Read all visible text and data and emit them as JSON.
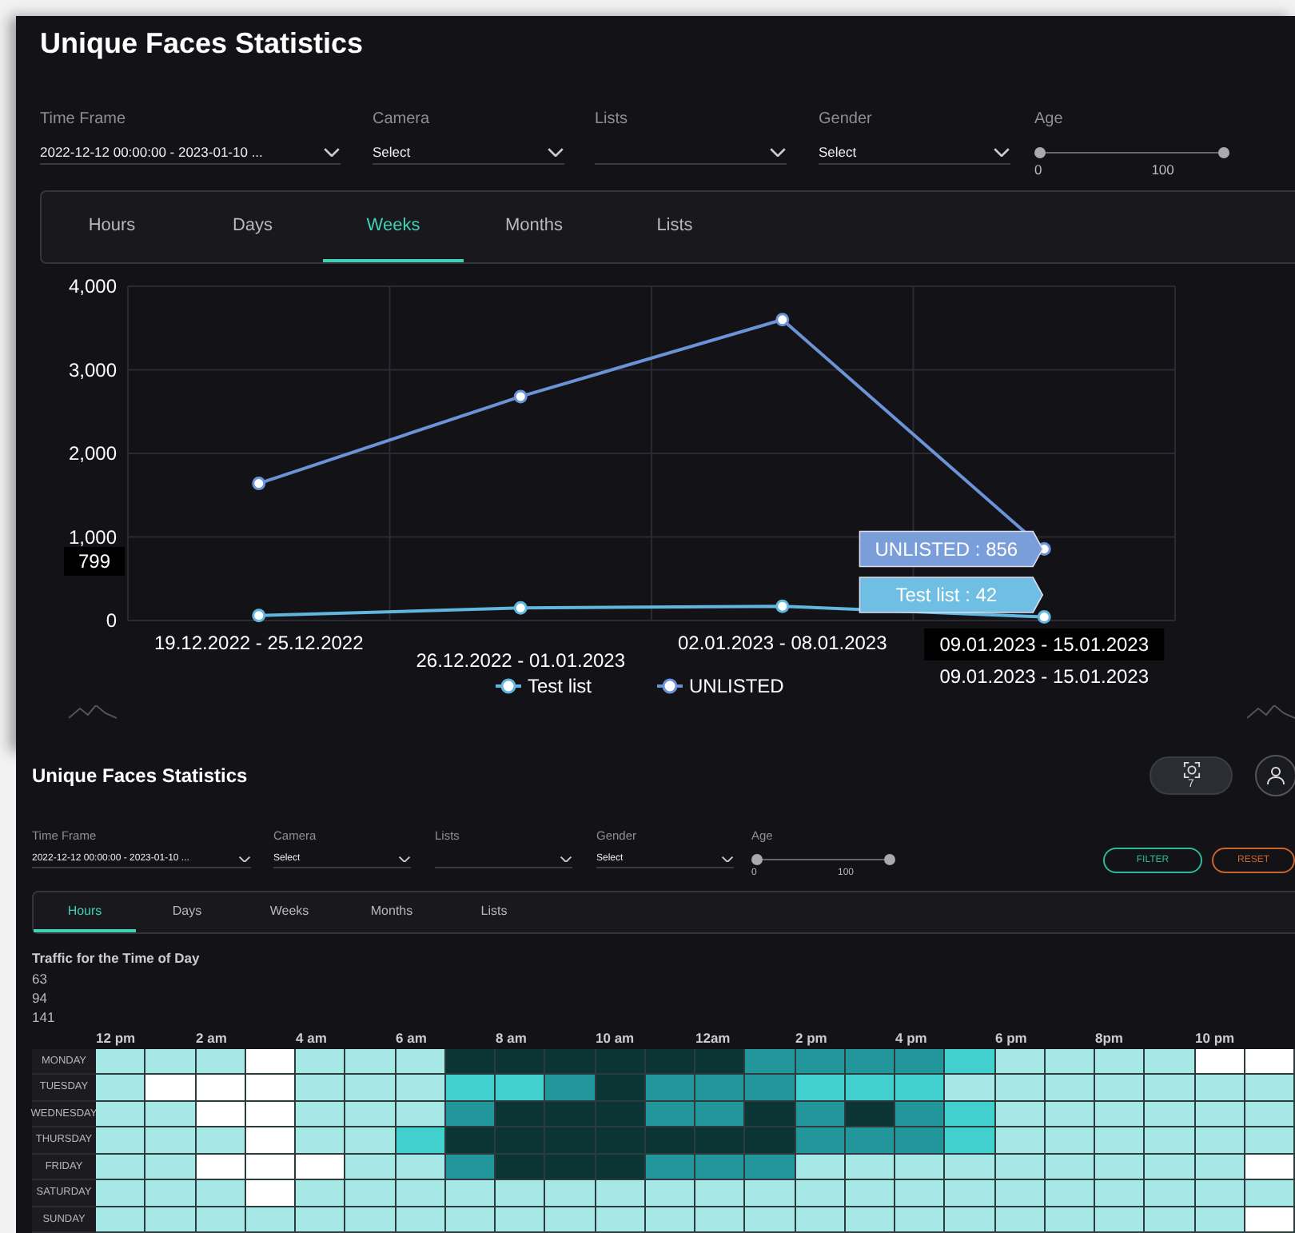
{
  "overview": {
    "title": "Unique Faces Statistics",
    "filters": [
      {
        "kind": "select",
        "label": "Time Frame",
        "value": "2022-12-12 00:00:00 - 2023-01-10 ..."
      },
      {
        "kind": "select",
        "label": "Camera",
        "placeholder": "Select"
      },
      {
        "kind": "select",
        "label": "Lists"
      },
      {
        "kind": "select",
        "label": "Gender",
        "placeholder": "Select"
      },
      {
        "kind": "range",
        "label": "Age",
        "min": "0",
        "max": "100"
      }
    ],
    "tabs": [
      {
        "label": "Hours",
        "selected": false
      },
      {
        "label": "Days",
        "selected": false
      },
      {
        "label": "Weeks",
        "selected": true
      },
      {
        "label": "Months",
        "selected": false
      },
      {
        "label": "Lists",
        "selected": false
      }
    ],
    "chart_data": {
      "type": "line",
      "grid": true,
      "legend": "bottom",
      "categories": [
        "19.12.2022 - 25.12.2022",
        "26.12.2022 - 01.01.2023",
        "02.01.2023 - 08.01.2023",
        "09.01.2023 - 15.01.2023"
      ],
      "series": [
        {
          "name": "Test list",
          "color": "#5fb7e0",
          "marker": "circle",
          "values": [
            60,
            150,
            170,
            42
          ]
        },
        {
          "name": "UNLISTED",
          "color": "#6b93d6",
          "marker": "circle",
          "values": [
            1640,
            2680,
            3600,
            856
          ]
        }
      ],
      "ylim": [
        0,
        4000
      ],
      "yticks": [
        {
          "value": 0,
          "label": "0"
        },
        {
          "value": 1000,
          "label": "1,000"
        },
        {
          "value": 2000,
          "label": "2,000"
        },
        {
          "value": 3000,
          "label": "3,000"
        },
        {
          "value": 4000,
          "label": "4,000"
        }
      ],
      "annotations": [
        {
          "text": "UNLISTED : 856",
          "x": "09.01.2023 - 15.01.2023",
          "y": 856
        },
        {
          "text": "Test list : 42",
          "x": "09.01.2023 - 15.01.2023",
          "y": 42
        },
        "799",
        "09.01.2023 - 15.01.2023"
      ]
    }
  },
  "hourly": {
    "title": "Unique Faces Statistics",
    "badge": "7",
    "filters": [
      {
        "kind": "select",
        "label": "Time Frame",
        "value": "2022-12-12 00:00:00 - 2023-01-10 ..."
      },
      {
        "kind": "select",
        "label": "Camera",
        "placeholder": "Select"
      },
      {
        "kind": "select",
        "label": "Lists"
      },
      {
        "kind": "select",
        "label": "Gender",
        "placeholder": "Select"
      },
      {
        "kind": "range",
        "label": "Age",
        "min": "0",
        "max": "100"
      }
    ],
    "actions": [
      {
        "kind": "primary",
        "label": "FILTER"
      },
      {
        "kind": "danger",
        "label": "RESET"
      }
    ],
    "tabs": [
      {
        "label": "Hours",
        "selected": true
      },
      {
        "label": "Days",
        "selected": false
      },
      {
        "label": "Weeks",
        "selected": false
      },
      {
        "label": "Months",
        "selected": false
      },
      {
        "label": "Lists",
        "selected": false
      }
    ],
    "heatmap": {
      "title": "Traffic for the Time of Day",
      "legend": [
        "63",
        "94",
        "141"
      ],
      "hours": [
        "12 pm",
        "2 am",
        "4 am",
        "6 am",
        "8 am",
        "10 am",
        "12am",
        "2 pm",
        "4 pm",
        "6 pm",
        "8pm",
        "10 pm"
      ],
      "rows": [
        {
          "day": "MONDAY",
          "cells": [
            {
              "color": "#a6e8e6"
            },
            {
              "color": "#a6e8e6"
            },
            {
              "color": "#a6e8e6"
            },
            {
              "color": "#ffffff"
            },
            {
              "color": "#a6e8e6"
            },
            {
              "color": "#a6e8e6"
            },
            {
              "color": "#a6e8e6"
            },
            {
              "color": "#0b3535"
            },
            {
              "color": "#0b3535"
            },
            {
              "color": "#0b3535"
            },
            {
              "color": "#0b3535"
            },
            {
              "color": "#0b3535"
            },
            {
              "color": "#0b3535"
            },
            {
              "color": "#22979b"
            },
            {
              "color": "#22979b"
            },
            {
              "color": "#22979b"
            },
            {
              "color": "#22979b"
            },
            {
              "color": "#40d0ce"
            },
            {
              "color": "#a6e8e6"
            },
            {
              "color": "#a6e8e6"
            },
            {
              "color": "#a6e8e6"
            },
            {
              "color": "#a6e8e6"
            },
            {
              "color": "#ffffff"
            },
            {
              "color": "#ffffff"
            }
          ]
        },
        {
          "day": "TUESDAY",
          "cells": [
            {
              "color": "#a6e8e6"
            },
            {
              "color": "#ffffff"
            },
            {
              "color": "#ffffff"
            },
            {
              "color": "#ffffff"
            },
            {
              "color": "#a6e8e6"
            },
            {
              "color": "#a6e8e6"
            },
            {
              "color": "#a6e8e6"
            },
            {
              "color": "#40d0ce"
            },
            {
              "color": "#40d0ce"
            },
            {
              "color": "#22979b"
            },
            {
              "color": "#0b3535"
            },
            {
              "color": "#22979b"
            },
            {
              "color": "#22979b"
            },
            {
              "color": "#22979b"
            },
            {
              "color": "#40d0ce"
            },
            {
              "color": "#40d0ce"
            },
            {
              "color": "#40d0ce"
            },
            {
              "color": "#a6e8e6"
            },
            {
              "color": "#a6e8e6"
            },
            {
              "color": "#a6e8e6"
            },
            {
              "color": "#a6e8e6"
            },
            {
              "color": "#a6e8e6"
            },
            {
              "color": "#a6e8e6"
            },
            {
              "color": "#a6e8e6"
            }
          ]
        },
        {
          "day": "WEDNESDAY",
          "cells": [
            {
              "color": "#a6e8e6"
            },
            {
              "color": "#a6e8e6"
            },
            {
              "color": "#ffffff"
            },
            {
              "color": "#ffffff"
            },
            {
              "color": "#a6e8e6"
            },
            {
              "color": "#a6e8e6"
            },
            {
              "color": "#a6e8e6"
            },
            {
              "color": "#22979b"
            },
            {
              "color": "#0b3535"
            },
            {
              "color": "#0b3535"
            },
            {
              "color": "#0b3535"
            },
            {
              "color": "#22979b"
            },
            {
              "color": "#22979b"
            },
            {
              "color": "#0b3535"
            },
            {
              "color": "#22979b"
            },
            {
              "color": "#0b3535"
            },
            {
              "color": "#22979b"
            },
            {
              "color": "#40d0ce"
            },
            {
              "color": "#a6e8e6"
            },
            {
              "color": "#a6e8e6"
            },
            {
              "color": "#a6e8e6"
            },
            {
              "color": "#a6e8e6"
            },
            {
              "color": "#a6e8e6"
            },
            {
              "color": "#a6e8e6"
            }
          ]
        },
        {
          "day": "THURSDAY",
          "cells": [
            {
              "color": "#a6e8e6"
            },
            {
              "color": "#a6e8e6"
            },
            {
              "color": "#a6e8e6"
            },
            {
              "color": "#ffffff"
            },
            {
              "color": "#a6e8e6"
            },
            {
              "color": "#a6e8e6"
            },
            {
              "color": "#40d0ce"
            },
            {
              "color": "#0b3535"
            },
            {
              "color": "#0b3535"
            },
            {
              "color": "#0b3535"
            },
            {
              "color": "#0b3535"
            },
            {
              "color": "#0b3535"
            },
            {
              "color": "#0b3535"
            },
            {
              "color": "#0b3535"
            },
            {
              "color": "#22979b"
            },
            {
              "color": "#22979b"
            },
            {
              "color": "#22979b"
            },
            {
              "color": "#40d0ce"
            },
            {
              "color": "#a6e8e6"
            },
            {
              "color": "#a6e8e6"
            },
            {
              "color": "#a6e8e6"
            },
            {
              "color": "#a6e8e6"
            },
            {
              "color": "#a6e8e6"
            },
            {
              "color": "#a6e8e6"
            }
          ]
        },
        {
          "day": "FRIDAY",
          "cells": [
            {
              "color": "#a6e8e6"
            },
            {
              "color": "#a6e8e6"
            },
            {
              "color": "#ffffff"
            },
            {
              "color": "#ffffff"
            },
            {
              "color": "#ffffff"
            },
            {
              "color": "#a6e8e6"
            },
            {
              "color": "#a6e8e6"
            },
            {
              "color": "#22979b"
            },
            {
              "color": "#0b3535"
            },
            {
              "color": "#0b3535"
            },
            {
              "color": "#0b3535"
            },
            {
              "color": "#22979b"
            },
            {
              "color": "#22979b"
            },
            {
              "color": "#22979b"
            },
            {
              "color": "#a6e8e6"
            },
            {
              "color": "#a6e8e6"
            },
            {
              "color": "#a6e8e6"
            },
            {
              "color": "#a6e8e6"
            },
            {
              "color": "#a6e8e6"
            },
            {
              "color": "#a6e8e6"
            },
            {
              "color": "#a6e8e6"
            },
            {
              "color": "#a6e8e6"
            },
            {
              "color": "#a6e8e6"
            },
            {
              "color": "#ffffff"
            }
          ]
        },
        {
          "day": "SATURDAY",
          "cells": [
            {
              "color": "#a6e8e6"
            },
            {
              "color": "#a6e8e6"
            },
            {
              "color": "#a6e8e6"
            },
            {
              "color": "#ffffff"
            },
            {
              "color": "#a6e8e6"
            },
            {
              "color": "#a6e8e6"
            },
            {
              "color": "#a6e8e6"
            },
            {
              "color": "#a6e8e6"
            },
            {
              "color": "#a6e8e6"
            },
            {
              "color": "#a6e8e6"
            },
            {
              "color": "#a6e8e6"
            },
            {
              "color": "#a6e8e6"
            },
            {
              "color": "#a6e8e6"
            },
            {
              "color": "#a6e8e6"
            },
            {
              "color": "#a6e8e6"
            },
            {
              "color": "#a6e8e6"
            },
            {
              "color": "#a6e8e6"
            },
            {
              "color": "#a6e8e6"
            },
            {
              "color": "#a6e8e6"
            },
            {
              "color": "#a6e8e6"
            },
            {
              "color": "#a6e8e6"
            },
            {
              "color": "#a6e8e6"
            },
            {
              "color": "#a6e8e6"
            },
            {
              "color": "#a6e8e6"
            }
          ]
        },
        {
          "day": "SUNDAY",
          "cells": [
            {
              "color": "#a6e8e6"
            },
            {
              "color": "#a6e8e6"
            },
            {
              "color": "#a6e8e6"
            },
            {
              "color": "#a6e8e6"
            },
            {
              "color": "#a6e8e6"
            },
            {
              "color": "#a6e8e6"
            },
            {
              "color": "#a6e8e6"
            },
            {
              "color": "#a6e8e6"
            },
            {
              "color": "#a6e8e6"
            },
            {
              "color": "#a6e8e6"
            },
            {
              "color": "#a6e8e6"
            },
            {
              "color": "#a6e8e6"
            },
            {
              "color": "#a6e8e6"
            },
            {
              "color": "#a6e8e6"
            },
            {
              "color": "#a6e8e6"
            },
            {
              "color": "#a6e8e6"
            },
            {
              "color": "#a6e8e6"
            },
            {
              "color": "#a6e8e6"
            },
            {
              "color": "#a6e8e6"
            },
            {
              "color": "#a6e8e6"
            },
            {
              "color": "#a6e8e6"
            },
            {
              "color": "#a6e8e6"
            },
            {
              "color": "#a6e8e6"
            },
            {
              "color": "#ffffff"
            }
          ]
        }
      ]
    }
  }
}
